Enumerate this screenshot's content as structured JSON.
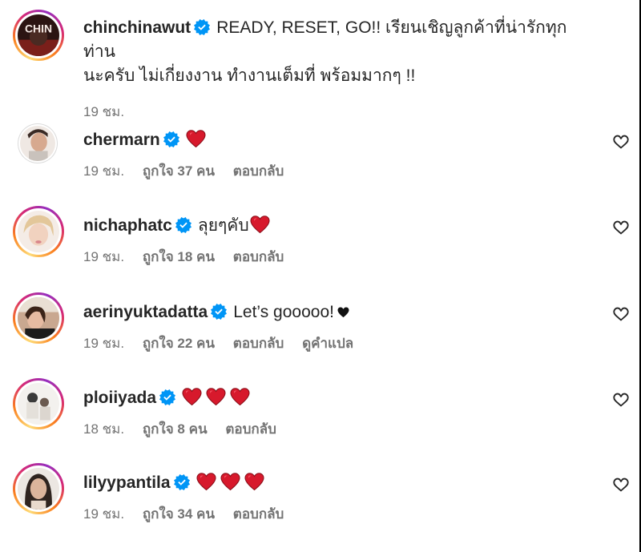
{
  "post": {
    "author": "chinchinawut",
    "caption_line1": "READY, RESET, GO!! เรียนเชิญลูกค้าที่น่ารักทุกท่าน",
    "caption_line2": "นะครับ ไม่เกี่ยงงาน ทำงานเต็มที่ พร้อมมากๆ !!",
    "time": "19 ชม.",
    "avatar_text": "CHIN"
  },
  "comments": [
    {
      "username": "chermarn",
      "text": "",
      "hearts": 1,
      "time": "19 ชม.",
      "likes": "ถูกใจ 37 คน",
      "reply": "ตอบกลับ",
      "translate": ""
    },
    {
      "username": "nichaphatc",
      "text": "ลุยๆคับ",
      "hearts": 1,
      "time": "19 ชม.",
      "likes": "ถูกใจ 18 คน",
      "reply": "ตอบกลับ",
      "translate": ""
    },
    {
      "username": "aerinyuktadatta",
      "text": "Let’s gooooo!",
      "hearts": 0,
      "black_heart": true,
      "time": "19 ชม.",
      "likes": "ถูกใจ 22 คน",
      "reply": "ตอบกลับ",
      "translate": "ดูคำแปล"
    },
    {
      "username": "ploiiyada",
      "text": "",
      "hearts": 3,
      "time": "18 ชม.",
      "likes": "ถูกใจ 8 คน",
      "reply": "ตอบกลับ",
      "translate": ""
    },
    {
      "username": "lilyypantila",
      "text": "",
      "hearts": 3,
      "time": "19 ชม.",
      "likes": "ถูกใจ 34 คน",
      "reply": "ตอบกลับ",
      "translate": ""
    }
  ],
  "icons": {
    "verified": "verified-badge-icon",
    "heart_emoji": "red-heart-emoji",
    "like": "heart-outline-icon"
  },
  "colors": {
    "text": "#262626",
    "secondary": "#737373",
    "verified": "#0095f6",
    "heart": "#e0245e"
  }
}
